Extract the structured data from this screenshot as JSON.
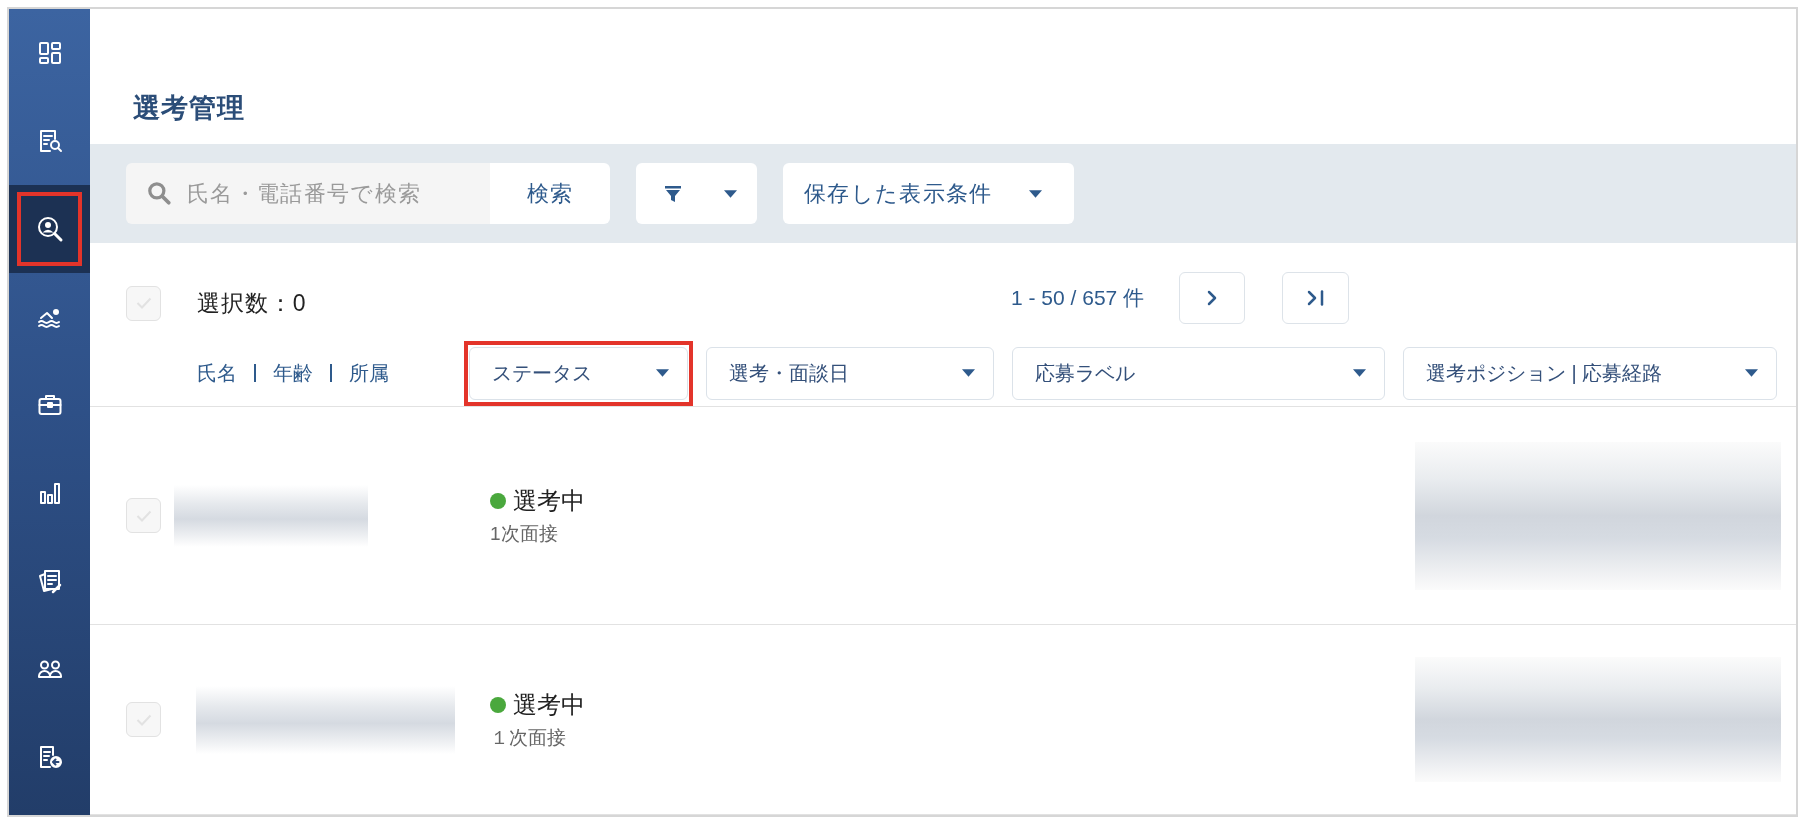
{
  "sidebar": {
    "items": [
      {
        "selected": false,
        "highlighted": false
      },
      {
        "selected": false,
        "highlighted": false
      },
      {
        "selected": true,
        "highlighted": true
      },
      {
        "selected": false,
        "highlighted": false
      },
      {
        "selected": false,
        "highlighted": false
      },
      {
        "selected": false,
        "highlighted": false
      },
      {
        "selected": false,
        "highlighted": false
      },
      {
        "selected": false,
        "highlighted": false
      },
      {
        "selected": false,
        "highlighted": false
      }
    ]
  },
  "page": {
    "title": "選考管理"
  },
  "toolbar": {
    "search": {
      "placeholder": "氏名・電話番号で検索",
      "button": "検索"
    },
    "saved_views": {
      "label": "保存した表示条件"
    }
  },
  "selection": {
    "checked": false,
    "count_label": "選択数：0"
  },
  "pagination": {
    "range": "1 - 50 / 657 件"
  },
  "columns": {
    "name_fields": [
      "氏名",
      "年齢",
      "所属"
    ],
    "filters": [
      {
        "label": "ステータス",
        "highlighted": true
      },
      {
        "label": "選考・面談日",
        "highlighted": false
      },
      {
        "label": "応募ラベル",
        "highlighted": false
      },
      {
        "label": "選考ポジション | 応募経路",
        "highlighted": false
      }
    ]
  },
  "rows": [
    {
      "checked": false,
      "status": {
        "label": "選考中",
        "color": "#4aa83d"
      },
      "stage": "1次面接"
    },
    {
      "checked": false,
      "status": {
        "label": "選考中",
        "color": "#4aa83d"
      },
      "stage": "１次面接"
    }
  ]
}
